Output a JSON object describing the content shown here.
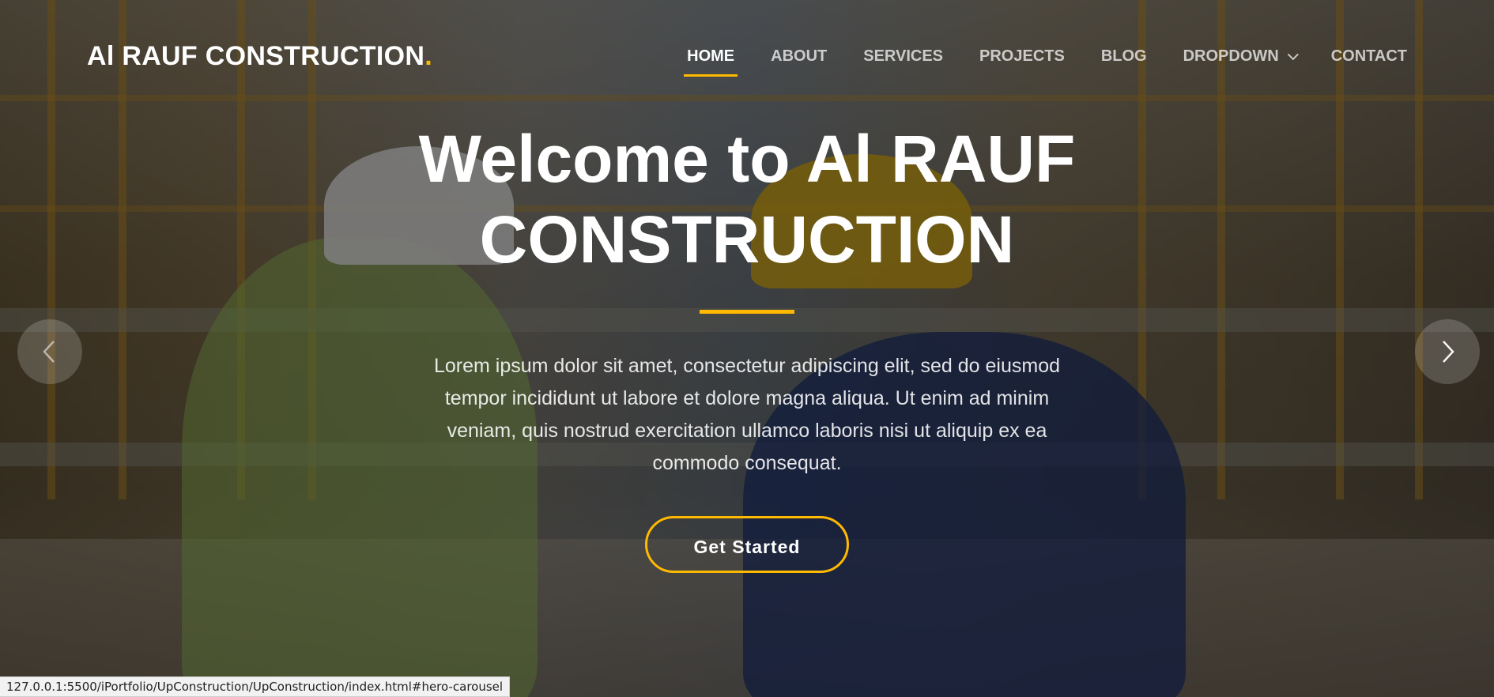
{
  "header": {
    "logo_text": "Al RAUF CONSTRUCTION",
    "logo_dot": ".",
    "nav": [
      {
        "label": "HOME",
        "active": true
      },
      {
        "label": "ABOUT",
        "active": false
      },
      {
        "label": "SERVICES",
        "active": false
      },
      {
        "label": "PROJECTS",
        "active": false
      },
      {
        "label": "BLOG",
        "active": false
      },
      {
        "label": "DROPDOWN",
        "active": false,
        "icon": "chevron-down-icon"
      },
      {
        "label": "CONTACT",
        "active": false
      }
    ]
  },
  "hero": {
    "title": "Welcome to Al RAUF CONSTRUCTION",
    "description": "Lorem ipsum dolor sit amet, consectetur adipiscing elit, sed do eiusmod tempor incididunt ut labore et dolore magna aliqua. Ut enim ad minim veniam, quis nostrud exercitation ullamco laboris nisi ut aliquip ex ea commodo consequat.",
    "cta_label": "Get Started"
  },
  "carousel": {
    "prev_icon": "chevron-left-icon",
    "next_icon": "chevron-right-icon"
  },
  "status_bar": {
    "url": "127.0.0.1:5500/iPortfolio/UpConstruction/UpConstruction/index.html#hero-carousel"
  },
  "colors": {
    "accent": "#feb900",
    "overlay": "rgba(0,0,0,0.45)",
    "text": "#ffffff"
  }
}
